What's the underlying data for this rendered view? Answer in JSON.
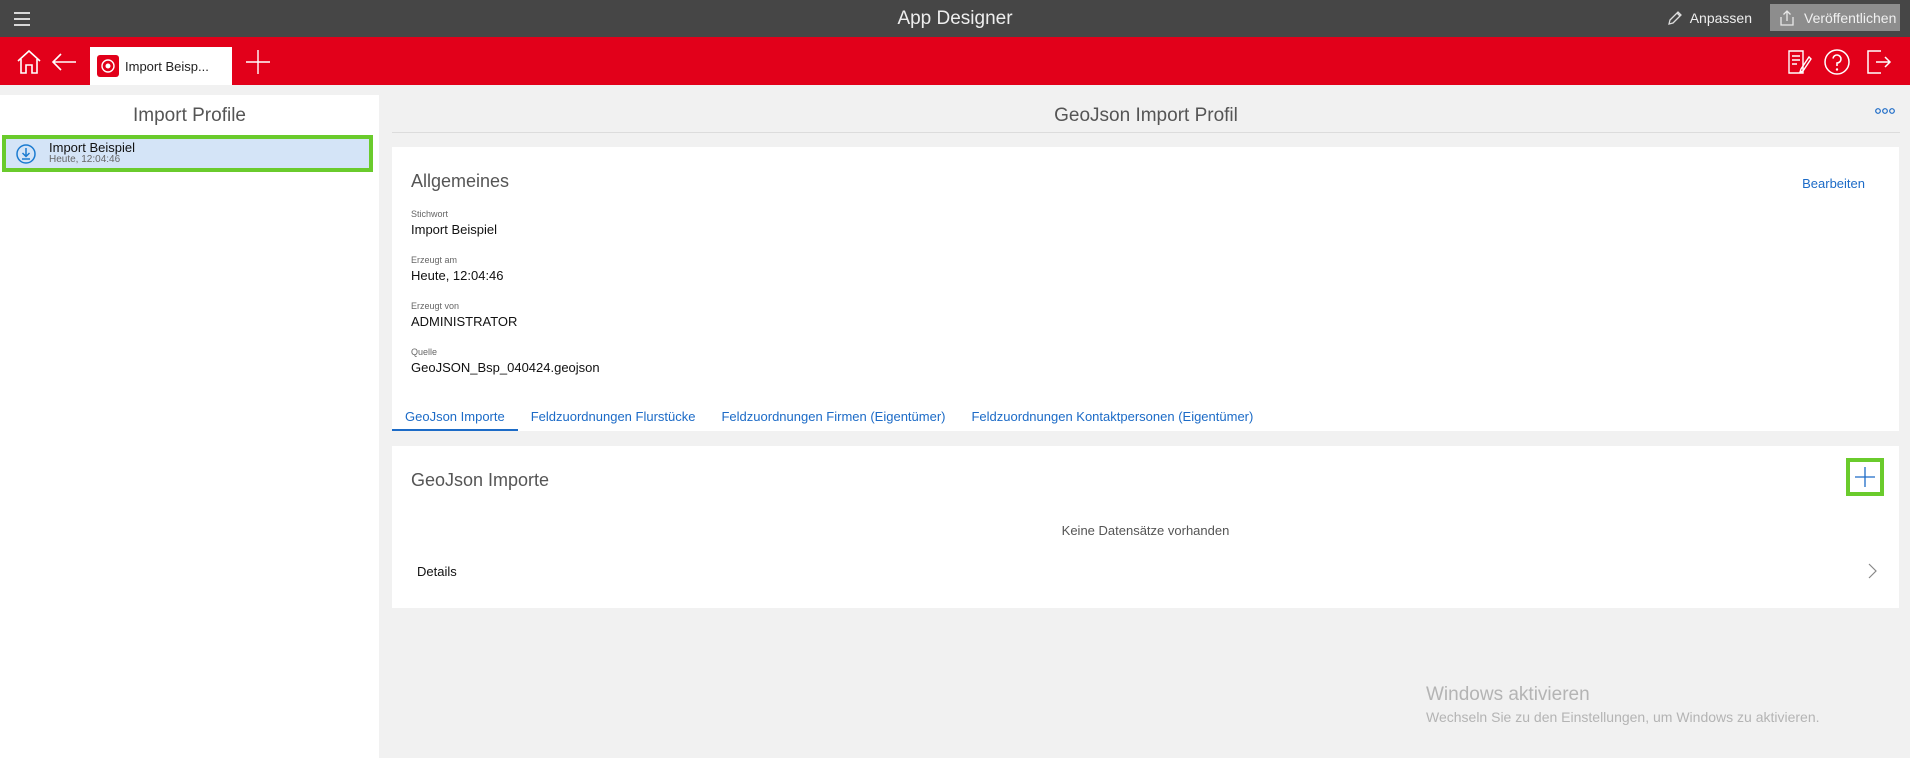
{
  "titlebar": {
    "title": "App Designer",
    "customize_label": "Anpassen",
    "publish_label": "Veröffentlichen"
  },
  "toolbar": {
    "icons": [
      "home-icon",
      "back-icon",
      "add-tab-icon",
      "notes-icon",
      "help-icon",
      "logout-icon"
    ],
    "tab_label": "Import Beisp..."
  },
  "left": {
    "heading": "Import Profile",
    "items": [
      {
        "title": "Import Beispiel",
        "subtitle": "Heute, 12:04:46",
        "icon": "download-icon"
      }
    ]
  },
  "main": {
    "title": "GeoJson Import Profil",
    "general": {
      "title": "Allgemeines",
      "edit_label": "Bearbeiten",
      "fields": [
        {
          "label": "Stichwort",
          "value": "Import Beispiel"
        },
        {
          "label": "Erzeugt am",
          "value": "Heute, 12:04:46"
        },
        {
          "label": "Erzeugt von",
          "value": "ADMINISTRATOR"
        },
        {
          "label": "Quelle",
          "value": "GeoJSON_Bsp_040424.geojson"
        }
      ]
    },
    "tabs": [
      {
        "label": "GeoJson Importe",
        "active": true
      },
      {
        "label": "Feldzuordnungen Flurstücke",
        "active": false
      },
      {
        "label": "Feldzuordnungen Firmen (Eigentümer)",
        "active": false
      },
      {
        "label": "Feldzuordnungen Kontaktpersonen (Eigentümer)",
        "active": false
      }
    ],
    "imports": {
      "title": "GeoJson Importe",
      "empty_text": "Keine Datensätze vorhanden",
      "details_label": "Details"
    }
  },
  "watermark": {
    "line1": "Windows aktivieren",
    "line2": "Wechseln Sie zu den Einstellungen, um Windows zu aktivieren."
  },
  "colors": {
    "accent_red": "#e2001a",
    "link_blue": "#1c6bc7",
    "highlight_green": "#6acb2c",
    "selection_blue": "#d4e4f7"
  }
}
